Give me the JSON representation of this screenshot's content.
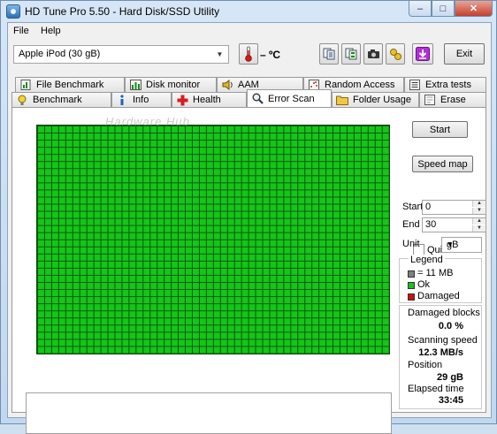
{
  "window": {
    "title": "HD Tune Pro 5.50 - Hard Disk/SSD Utility",
    "minimize": "–",
    "maximize": "□",
    "close": "✕"
  },
  "menu": {
    "file": "File",
    "help": "Help"
  },
  "toolbar": {
    "drive": "Apple   iPod (30 gB)",
    "temperature": "– ºC",
    "exit": "Exit"
  },
  "icons": {
    "thermometer": "thermometer-icon",
    "copy_text": "copy-info-icon",
    "copy_list": "copy-list-icon",
    "screenshot": "camera-icon",
    "options": "options-icon",
    "save": "save-icon"
  },
  "tabs_top": [
    {
      "label": "File Benchmark",
      "icon": "file-benchmark-icon"
    },
    {
      "label": "Disk monitor",
      "icon": "disk-monitor-icon"
    },
    {
      "label": "AAM",
      "icon": "speaker-icon"
    },
    {
      "label": "Random Access",
      "icon": "random-access-icon"
    },
    {
      "label": "Extra tests",
      "icon": "extra-tests-icon"
    }
  ],
  "tabs_bottom": [
    {
      "label": "Benchmark",
      "icon": "benchmark-icon"
    },
    {
      "label": "Info",
      "icon": "info-icon"
    },
    {
      "label": "Health",
      "icon": "health-icon"
    },
    {
      "label": "Error Scan",
      "icon": "magnifier-icon"
    },
    {
      "label": "Folder Usage",
      "icon": "folder-icon"
    },
    {
      "label": "Erase",
      "icon": "erase-icon"
    }
  ],
  "watermark": "Hardware Hub",
  "scan": {
    "start_btn": "Start",
    "quick_scan": "Quick scan",
    "quick_scan_checked": false,
    "speed_map": "Speed map",
    "start_label": "Start",
    "start_value": "0",
    "end_label": "End",
    "end_value": "30",
    "unit_label": "Unit",
    "unit_value": "gB",
    "block_state": "ok",
    "colors": {
      "ok": "#16c41a",
      "damaged": "#cc1010",
      "unscanned": "#808080"
    }
  },
  "legend": {
    "title": "Legend",
    "block": "= 11 MB",
    "ok": "Ok",
    "damaged": "Damaged"
  },
  "stats": {
    "damaged_label": "Damaged blocks",
    "damaged_value": "0.0 %",
    "speed_label": "Scanning speed",
    "speed_value": "12.3 MB/s",
    "position_label": "Position",
    "position_value": "29 gB",
    "elapsed_label": "Elapsed time",
    "elapsed_value": "33:45"
  }
}
